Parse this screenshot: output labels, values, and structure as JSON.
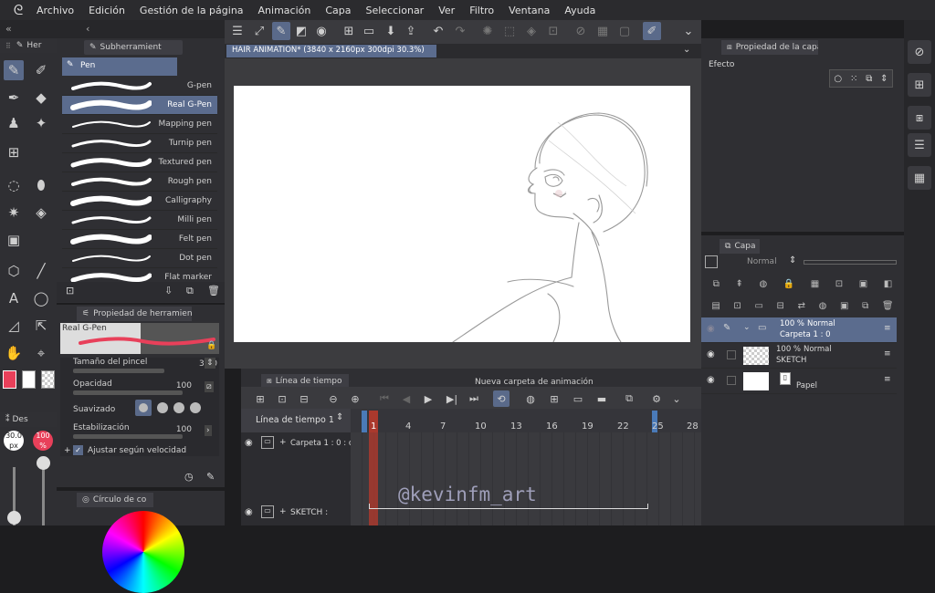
{
  "menu": {
    "logo_icon": "clip-studio-logo",
    "items": [
      "Archivo",
      "Edición",
      "Gestión de la página",
      "Animación",
      "Capa",
      "Seleccionar",
      "Ver",
      "Filtro",
      "Ventana",
      "Ayuda"
    ]
  },
  "tool_panel": {
    "tab_label": "Her"
  },
  "sub_tool": {
    "header": "Subherramient",
    "group": "Pen",
    "brushes": [
      "G-pen",
      "Real G-Pen",
      "Mapping pen",
      "Turnip pen",
      "Textured pen",
      "Rough pen",
      "Calligraphy",
      "Milli pen",
      "Felt pen",
      "Dot pen",
      "Flat marker"
    ],
    "selected_index": 1
  },
  "tool_property": {
    "header": "Propiedad de herramient",
    "brush_name": "Real G-Pen",
    "brush_size_label": "Tamaño del pincel",
    "brush_size_value": "30.0",
    "opacity_label": "Opacidad",
    "opacity_value": "100",
    "smoothing_label": "Suavizado",
    "stabilization_label": "Estabilización",
    "stabilization_value": "100",
    "adjust_speed_label": "Ajustar según velocidad"
  },
  "brush_size_panel": {
    "tab_label": "Des",
    "size_text": "30.0 px",
    "opacity_text": "100 %"
  },
  "color_panel": {
    "header": "Círculo de co"
  },
  "canvas": {
    "tab_title": "HAIR ANIMATION* (3840 x 2160px 300dpi 30.3%)"
  },
  "layer_property": {
    "header": "Propiedad de la capa",
    "effect_label": "Efecto"
  },
  "layers": {
    "header": "Capa",
    "blend_mode": "Normal",
    "rows": [
      {
        "opacity": "100 %",
        "mode": "Normal",
        "name": "Carpeta 1 : 0"
      },
      {
        "opacity": "100 %",
        "mode": "Normal",
        "name": "SKETCH"
      },
      {
        "name": "Papel"
      }
    ]
  },
  "timeline": {
    "header": "Línea de tiempo",
    "new_folder_label": "Nueva carpeta de animación",
    "name": "Línea de tiempo 1",
    "frames": [
      "1",
      "4",
      "7",
      "10",
      "13",
      "16",
      "19",
      "22",
      "25",
      "28"
    ],
    "tracks": [
      "Carpeta 1 : 0 : cel",
      "SKETCH :"
    ],
    "watermark": "@kevinfm_art"
  },
  "colors": {
    "accent": "#5a6a8a",
    "main_color": "#e8405a",
    "playhead": "#c0392b",
    "canvas_bg": "#ffffff",
    "workspace_bg": "#3c3c3f"
  }
}
